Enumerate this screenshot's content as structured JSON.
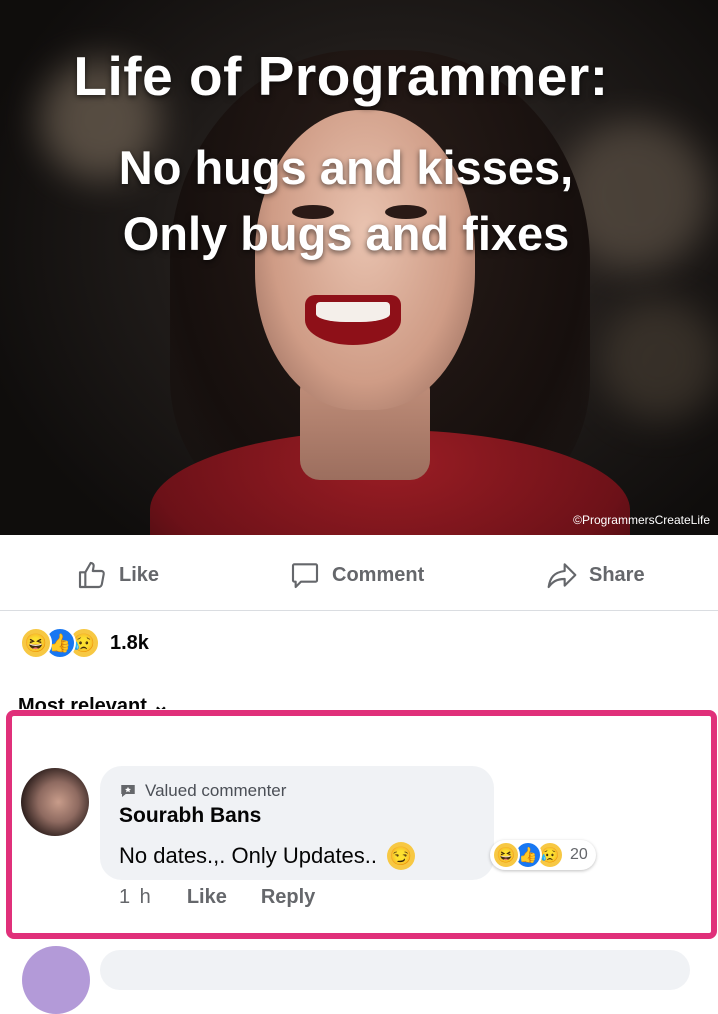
{
  "meme": {
    "title": "Life of Programmer:",
    "line1": "No hugs and kisses,",
    "line2": "Only bugs and fixes",
    "credit": "©ProgrammersCreateLife"
  },
  "actions": {
    "like": "Like",
    "comment": "Comment",
    "share": "Share"
  },
  "reactions": {
    "icons": [
      "haha-icon",
      "like-icon",
      "sad-icon"
    ],
    "count": "1.8k"
  },
  "sort_label": "Most relevant ⌄",
  "comment": {
    "badge": "Valued commenter",
    "author": "Sourabh Bans",
    "text": "No dates.,. Only Updates..",
    "emoji": "smirk-face",
    "reaction_count": "20",
    "time": "1 h",
    "like": "Like",
    "reply": "Reply"
  },
  "colors": {
    "highlight_border": "#e0307a",
    "bubble_bg": "#f0f2f5",
    "muted_text": "#65676b",
    "like_blue": "#1877f2"
  }
}
